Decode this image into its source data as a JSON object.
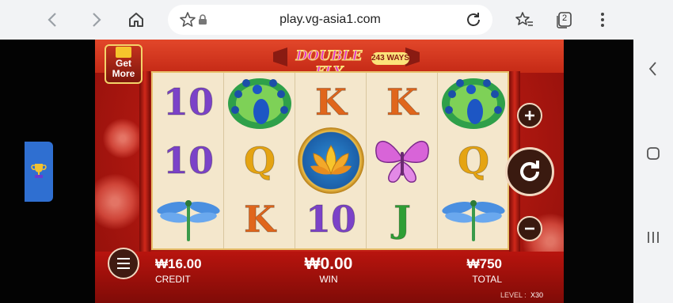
{
  "browser": {
    "url": "play.vg-asia1.com",
    "tab_count": "2",
    "icons": [
      "back-icon",
      "forward-icon",
      "home-icon",
      "star-icon",
      "lock-icon",
      "reload-icon",
      "bookmarks-icon",
      "tabs-icon",
      "more-icon"
    ]
  },
  "game": {
    "get_more_line1": "Get",
    "get_more_line2": "More",
    "logo_title": "DOUBLE FLY",
    "logo_badge": "243 WAYS",
    "reels": [
      [
        "10",
        "10",
        "dragonfly"
      ],
      [
        "peacock",
        "Q",
        "K"
      ],
      [
        "lotus",
        "lotus",
        "10"
      ],
      [
        "K",
        "butterfly",
        "J"
      ],
      [
        "peacock",
        "Q",
        "dragonfly"
      ]
    ],
    "credit_value": "₩16.00",
    "credit_label": "CREDIT",
    "win_value": "₩0.00",
    "win_label": "WIN",
    "total_value": "₩750",
    "total_label": "TOTAL",
    "level_label": "LEVEL :",
    "level_value": "X30"
  },
  "colors": {
    "accent_red": "#c0211a",
    "gold": "#e7c06b",
    "trophy_tab": "#2f6fd1"
  }
}
